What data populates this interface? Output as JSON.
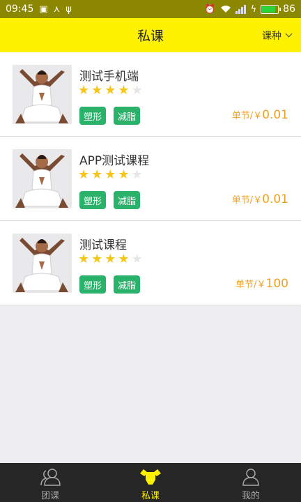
{
  "status_bar": {
    "time": "09:45",
    "battery_percent": "86",
    "battery_level": 0.86
  },
  "header": {
    "title": "私课",
    "filter_label": "课种"
  },
  "courses": [
    {
      "name": "测试手机端",
      "rating": 4,
      "max_rating": 5,
      "tags": [
        "塑形",
        "减脂"
      ],
      "price_prefix": "单节/￥",
      "price_value": "0.01"
    },
    {
      "name": "APP测试课程",
      "rating": 4,
      "max_rating": 5,
      "tags": [
        "塑形",
        "减脂"
      ],
      "price_prefix": "单节/￥",
      "price_value": "0.01"
    },
    {
      "name": "测试课程",
      "rating": 4,
      "max_rating": 5,
      "tags": [
        "塑形",
        "减脂"
      ],
      "price_prefix": "单节/￥",
      "price_value": "100"
    }
  ],
  "tabbar": {
    "items": [
      {
        "label": "团课",
        "icon": "group-icon",
        "active": false
      },
      {
        "label": "私课",
        "icon": "muscle-icon",
        "active": true
      },
      {
        "label": "我的",
        "icon": "person-icon",
        "active": false
      }
    ]
  },
  "colors": {
    "accent": "#fff200",
    "tag": "#2ab26a",
    "price": "#f0a020",
    "star": "#f5c518",
    "tabbar": "#262626"
  }
}
